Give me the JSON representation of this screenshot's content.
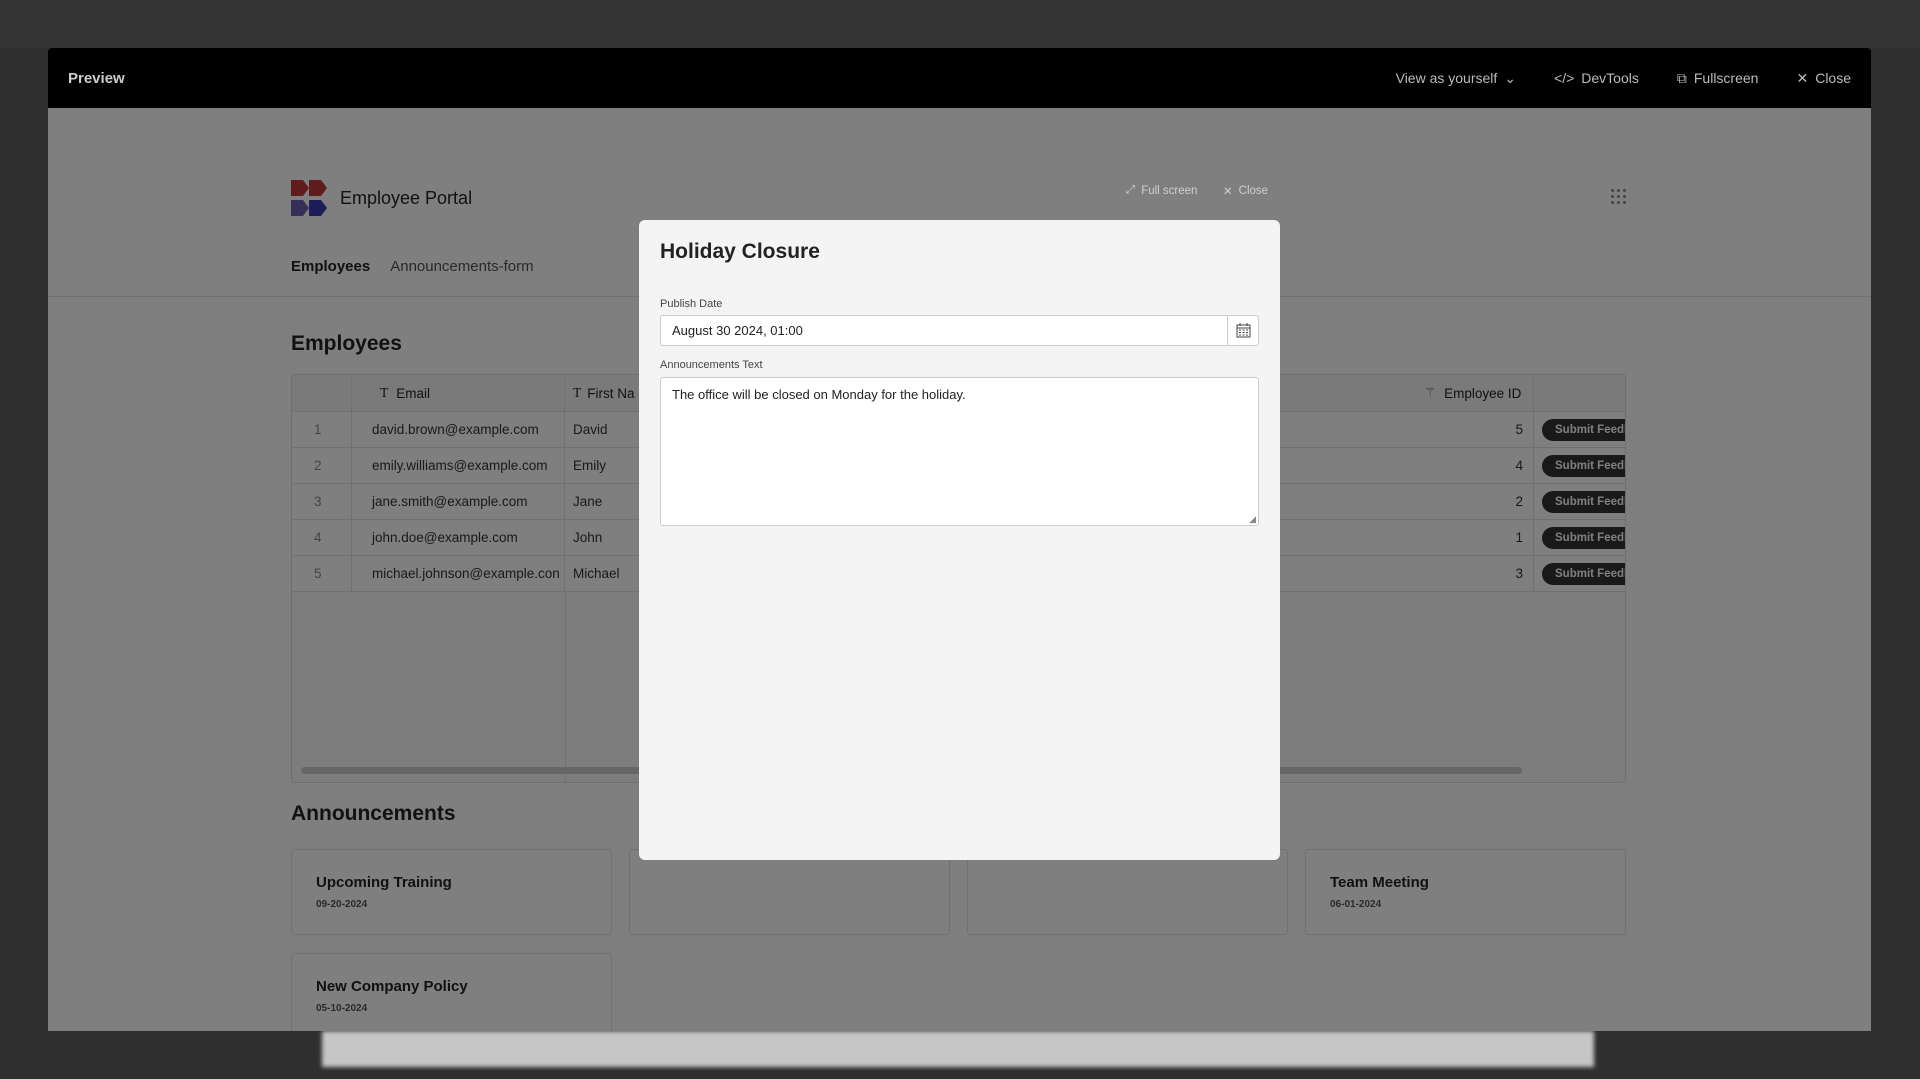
{
  "preview_bar": {
    "title": "Preview",
    "view_as": "View as yourself",
    "devtools": "DevTools",
    "fullscreen": "Fullscreen",
    "close": "Close"
  },
  "app": {
    "title": "Employee Portal",
    "tabs": [
      "Employees",
      "Announcements-form"
    ],
    "brand_colors": [
      "#c0393b",
      "#3b3bb0"
    ]
  },
  "employees": {
    "heading": "Employees",
    "columns": [
      "Email",
      "First Na",
      "Employee ID"
    ],
    "rows": [
      {
        "n": "1",
        "email": "david.brown@example.com",
        "first": "David",
        "id": "5",
        "action": "Submit Feedback"
      },
      {
        "n": "2",
        "email": "emily.williams@example.com",
        "first": "Emily",
        "id": "4",
        "action": "Submit Feedback"
      },
      {
        "n": "3",
        "email": "jane.smith@example.com",
        "first": "Jane",
        "id": "2",
        "action": "Submit Feedback"
      },
      {
        "n": "4",
        "email": "john.doe@example.com",
        "first": "John",
        "id": "1",
        "action": "Submit Feedback"
      },
      {
        "n": "5",
        "email": "michael.johnson@example.con",
        "first": "Michael",
        "id": "3",
        "action": "Submit Feedback"
      }
    ]
  },
  "announcements": {
    "heading": "Announcements",
    "cards": [
      {
        "title": "Upcoming Training",
        "date": "09-20-2024"
      },
      {
        "title": "",
        "date": ""
      },
      {
        "title": "",
        "date": ""
      },
      {
        "title": "Team Meeting",
        "date": "06-01-2024"
      },
      {
        "title": "New Company Policy",
        "date": "05-10-2024"
      }
    ]
  },
  "modal": {
    "full_screen": "Full screen",
    "close": "Close",
    "title": "Holiday Closure",
    "publish_label": "Publish Date",
    "publish_value": "August 30 2024, 01:00",
    "text_label": "Announcements Text",
    "text_value": "The office will be closed on Monday for the holiday."
  }
}
